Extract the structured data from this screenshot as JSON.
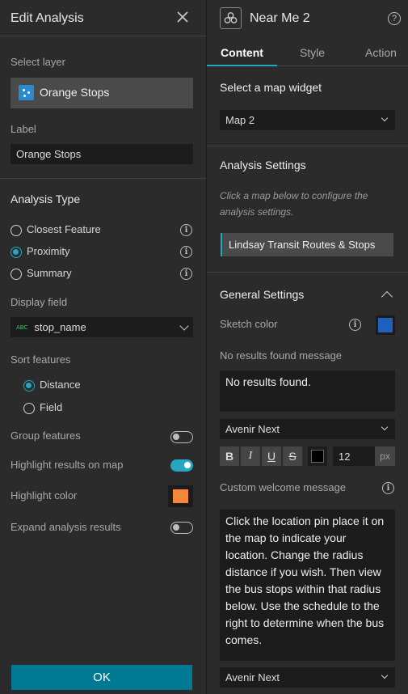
{
  "left_panel": {
    "title": "Edit Analysis",
    "select_layer_label": "Select layer",
    "layer_name": "Orange Stops",
    "label_label": "Label",
    "label_value": "Orange Stops",
    "analysis_type_heading": "Analysis Type",
    "analysis_types": [
      {
        "label": "Closest Feature",
        "selected": false
      },
      {
        "label": "Proximity",
        "selected": true
      },
      {
        "label": "Summary",
        "selected": false
      }
    ],
    "display_field_label": "Display field",
    "display_field_type_badge": "ABC",
    "display_field_value": "stop_name",
    "sort_features_label": "Sort features",
    "sort_options": [
      {
        "label": "Distance",
        "selected": true
      },
      {
        "label": "Field",
        "selected": false
      }
    ],
    "group_features_label": "Group features",
    "group_features_on": false,
    "highlight_results_label": "Highlight results on map",
    "highlight_results_on": true,
    "highlight_color_label": "Highlight color",
    "highlight_color": "#f5883a",
    "expand_results_label": "Expand analysis results",
    "expand_results_on": false,
    "ok_label": "OK"
  },
  "right_panel": {
    "title": "Near Me 2",
    "tabs": [
      {
        "label": "Content",
        "active": true
      },
      {
        "label": "Style",
        "active": false
      },
      {
        "label": "Action",
        "active": false
      }
    ],
    "select_map_widget_heading": "Select a map widget",
    "map_widget_value": "Map 2",
    "analysis_settings_heading": "Analysis Settings",
    "analysis_settings_hint": "Click a map below to configure the analysis settings.",
    "map_item": "Lindsay Transit Routes & Stops",
    "general_settings_heading": "General Settings",
    "sketch_color_label": "Sketch color",
    "sketch_color": "#1f5fbf",
    "no_results_label": "No results found message",
    "no_results_value": "No results found.",
    "font_value": "Avenir Next",
    "font_size": "12",
    "font_size_unit": "px",
    "text_color": "#000000",
    "format_buttons": [
      "B",
      "I",
      "U",
      "S"
    ],
    "welcome_label": "Custom welcome message",
    "welcome_value": "Click the location pin place it on the map to indicate your location. Change the radius distance if you wish. Then view the bus stops within that radius below. Use the schedule to the right to determine when the bus comes.",
    "welcome_font_value": "Avenir Next"
  },
  "colors": {
    "accent": "#27a6c2",
    "ok_button": "#007a94",
    "panel_bg": "#2b2b2b"
  }
}
